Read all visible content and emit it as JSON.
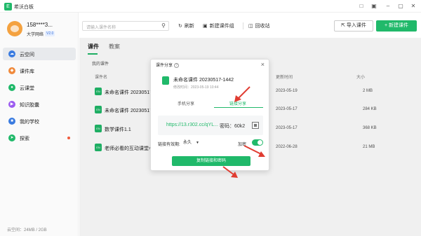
{
  "titlebar": {
    "app_name": "希沃白板"
  },
  "sidebar": {
    "user_name": "158****3...",
    "school": "大学网络",
    "badge": "V2.0",
    "items": [
      {
        "label": "云空间",
        "active": true,
        "icon": "cloud-icon",
        "color": "#3a7be0"
      },
      {
        "label": "课件库",
        "active": false,
        "icon": "layers-icon",
        "color": "#f08a3c"
      },
      {
        "label": "云课堂",
        "active": false,
        "icon": "classroom-icon",
        "color": "#20b96a"
      },
      {
        "label": "知识胶囊",
        "active": false,
        "icon": "capsule-icon",
        "color": "#9c5cf0"
      },
      {
        "label": "我的学校",
        "active": false,
        "icon": "school-icon",
        "color": "#3a7be0"
      },
      {
        "label": "探索",
        "active": false,
        "icon": "rocket-icon",
        "color": "#20b96a"
      }
    ],
    "storage": "云空间：24MB / 2GB"
  },
  "toolbar": {
    "search_placeholder": "请输入课件名称",
    "refresh": "刷新",
    "new_group": "新建课件组",
    "recycle": "回收站",
    "import": "导入课件",
    "new_courseware": "新建课件"
  },
  "main": {
    "tabs": [
      "课件",
      "教案"
    ],
    "section": "我的课件",
    "columns": {
      "name": "课件名",
      "updated": "更新时间",
      "size": "大小"
    },
    "rows": [
      {
        "name": "未命名课件 20230517",
        "date": "2023-05-19",
        "size": "2 MB"
      },
      {
        "name": "未命名课件 20230517",
        "date": "2023-05-17",
        "size": "284 KB"
      },
      {
        "name": "数学课件1.1",
        "date": "2023-05-17",
        "size": "368 KB"
      },
      {
        "name": "老师必看的互动课堂小",
        "date": "2022-06-28",
        "size": "21 MB"
      }
    ]
  },
  "modal": {
    "title": "课件分享",
    "file_name": "未命名课件 20230517-1442",
    "file_meta": "修改时间：2023-05-19 10:44",
    "tabs": [
      "手机分享",
      "链接分享"
    ],
    "link": "https://13.r302.cc/qYL...",
    "password": "密码：60k2",
    "validity_label": "链接有效期:",
    "validity_value": "永久",
    "encrypt_label": "加密",
    "copy_button": "复制链接和密码"
  },
  "accent_color": "#20b96a"
}
